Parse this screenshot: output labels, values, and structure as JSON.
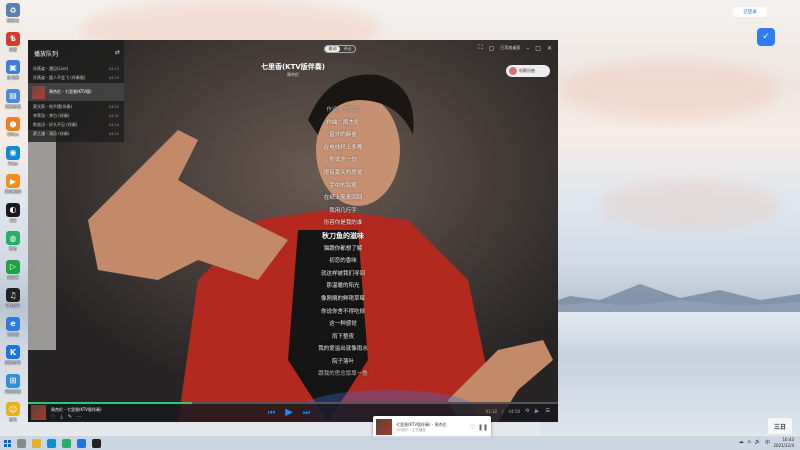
{
  "desktop_icons": [
    {
      "label": "回收站",
      "color": "#5a7fb0",
      "glyph": "♻"
    },
    {
      "label": "迅雷",
      "color": "#d83b2e",
      "glyph": "ѣ"
    },
    {
      "label": "此电脑",
      "color": "#3d7fd6",
      "glyph": "▣"
    },
    {
      "label": "控制面板",
      "color": "#4a8bd8",
      "glyph": "▤"
    },
    {
      "label": "Office",
      "color": "#e8811f",
      "glyph": "⬢"
    },
    {
      "label": "Edge",
      "color": "#0f8bd8",
      "glyph": "◉"
    },
    {
      "label": "腾讯视频",
      "color": "#f38d1c",
      "glyph": "▶"
    },
    {
      "label": "QQ",
      "color": "#1a1a1a",
      "glyph": "◐"
    },
    {
      "label": "微信",
      "color": "#2aae67",
      "glyph": "◍"
    },
    {
      "label": "爱奇艺",
      "color": "#1fa345",
      "glyph": "▷"
    },
    {
      "label": "QQ音乐",
      "color": "#222222",
      "glyph": "♫"
    },
    {
      "label": "浏览器",
      "color": "#2b7de0",
      "glyph": "e"
    },
    {
      "label": "酷狗音乐",
      "color": "#1b74e0",
      "glyph": "K"
    },
    {
      "label": "网络配置",
      "color": "#2c91d6",
      "glyph": "⊞"
    },
    {
      "label": "音乐",
      "color": "#e8b21c",
      "glyph": "☺"
    }
  ],
  "top_pill": {
    "label": "已登录"
  },
  "player": {
    "tabs": [
      "歌词",
      "评论"
    ],
    "active_tab": "歌词",
    "song_title": "七里香(KTV版伴奏)",
    "artist": "周杰伦",
    "comment_pill": "听歌识曲",
    "sidebar": {
      "title": "播放队列",
      "items": [
        {
          "title": "孙燕姿 - 遇见(Live)",
          "dur": "04:13"
        },
        {
          "title": "孙燕姿 - 超人不会飞 (伴奏版)",
          "dur": "04:23"
        },
        {
          "title": "周杰伦 - 七里香(KTV版)",
          "dur": "04:59"
        },
        {
          "title": "莫文蔚 - 他不懂(伴奏)",
          "dur": "04:52"
        },
        {
          "title": "李荣浩 - 李白 (伴奏)",
          "dur": "04:31"
        },
        {
          "title": "陈奕迅 - 好久不见 (伴奏)",
          "dur": "04:10"
        },
        {
          "title": "薛之谦 - 演员 (伴奏)",
          "dur": "04:21"
        }
      ],
      "playing": "周杰伦 - 七里香(KTV版)"
    },
    "lyrics": [
      {
        "text": "作词：方文山",
        "cls": "dim"
      },
      {
        "text": "作曲：周杰伦",
        "cls": ""
      },
      {
        "text": "窗外的麻雀",
        "cls": ""
      },
      {
        "text": "在电线杆上多嘴",
        "cls": ""
      },
      {
        "text": "你说这一句",
        "cls": ""
      },
      {
        "text": "很有夏天的感觉",
        "cls": ""
      },
      {
        "text": "手中的铅笔",
        "cls": ""
      },
      {
        "text": "在纸上来来回回",
        "cls": ""
      },
      {
        "text": "我用几行字",
        "cls": ""
      },
      {
        "text": "形容你是我的谁",
        "cls": ""
      },
      {
        "text": "秋刀鱼的滋味",
        "cls": "active"
      },
      {
        "text": "猫跟你都想了解",
        "cls": ""
      },
      {
        "text": "初恋的香味",
        "cls": ""
      },
      {
        "text": "就这样被我们寻回",
        "cls": ""
      },
      {
        "text": "那温暖的阳光",
        "cls": ""
      },
      {
        "text": "像刚摘的鲜艳草莓",
        "cls": ""
      },
      {
        "text": "你说你舍不得吃掉",
        "cls": ""
      },
      {
        "text": "这一种感觉",
        "cls": ""
      },
      {
        "text": "雨下整夜",
        "cls": ""
      },
      {
        "text": "我的爱溢出就像雨水",
        "cls": ""
      },
      {
        "text": "院子落叶",
        "cls": ""
      },
      {
        "text": "跟我的思念厚厚一叠",
        "cls": "dim"
      }
    ],
    "bottom": {
      "title": "周杰伦 - 七里香(KTV版伴奏)",
      "current_time": "01:32",
      "total_time": "04:59",
      "progress_fraction": 0.31
    },
    "window_ctrl_text": "已添加桌面"
  },
  "mini_player": {
    "line1": "七里香(KTV版伴奏) - 周杰伦",
    "line2": "QQ音乐 · 正在播放"
  },
  "taskbar": {
    "time": "16:43",
    "date": "2021/12/4"
  },
  "colors": {
    "accent": "#1a8cff",
    "progress": "#31c27c"
  }
}
